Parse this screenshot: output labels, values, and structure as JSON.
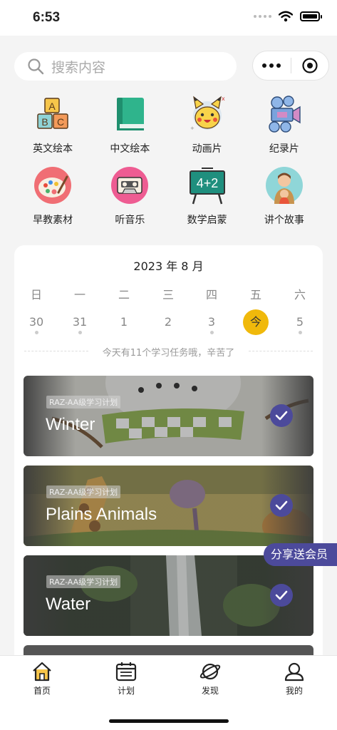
{
  "status": {
    "time": "6:53"
  },
  "search": {
    "placeholder": "搜索内容"
  },
  "categories": [
    {
      "label": "英文绘本",
      "icon": "abc-blocks-icon"
    },
    {
      "label": "中文绘本",
      "icon": "green-book-icon"
    },
    {
      "label": "动画片",
      "icon": "pikachu-icon"
    },
    {
      "label": "纪录片",
      "icon": "film-camera-icon"
    },
    {
      "label": "早教素材",
      "icon": "paint-palette-icon"
    },
    {
      "label": "听音乐",
      "icon": "cassette-icon"
    },
    {
      "label": "数学启蒙",
      "icon": "chalkboard-icon"
    },
    {
      "label": "讲个故事",
      "icon": "parent-child-icon"
    }
  ],
  "icon_text": {
    "board_sum": "4+2",
    "blocks": [
      "A",
      "B",
      "C"
    ]
  },
  "calendar": {
    "title": "2023 年 8 月",
    "weekdays": [
      "日",
      "一",
      "二",
      "三",
      "四",
      "五",
      "六"
    ],
    "dates": [
      {
        "label": "30",
        "dot": true
      },
      {
        "label": "31",
        "dot": true
      },
      {
        "label": "1",
        "dot": false
      },
      {
        "label": "2",
        "dot": false
      },
      {
        "label": "3",
        "dot": true
      },
      {
        "label": "今",
        "dot": false,
        "today": true
      },
      {
        "label": "5",
        "dot": true
      }
    ],
    "note": "今天有11个学习任务哦，辛苦了"
  },
  "plans": [
    {
      "tag": "RAZ-AA级学习计划",
      "title": "Winter",
      "completed": true
    },
    {
      "tag": "RAZ-AA级学习计划",
      "title": "Plains Animals",
      "completed": true
    },
    {
      "tag": "RAZ-AA级学习计划",
      "title": "Water",
      "completed": true
    }
  ],
  "share": {
    "label": "分享送会员"
  },
  "tabs": [
    {
      "label": "首页",
      "icon": "home-icon",
      "active": true
    },
    {
      "label": "计划",
      "icon": "calendar-icon"
    },
    {
      "label": "发现",
      "icon": "planet-icon"
    },
    {
      "label": "我的",
      "icon": "profile-icon"
    }
  ],
  "colors": {
    "accent": "#4c4a9b",
    "today": "#f0b90b",
    "background": "#f4f4f4"
  }
}
